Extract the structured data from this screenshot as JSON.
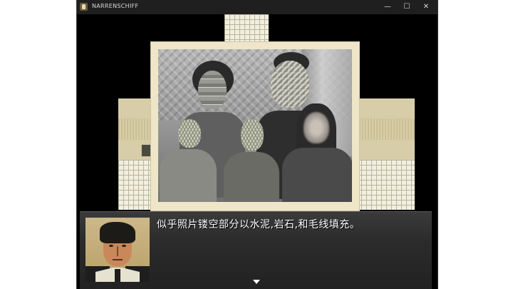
{
  "window": {
    "title": "NARRENSCHIFF",
    "icons": {
      "app": "app-icon",
      "minimize": "minimize-icon",
      "maximize": "maximize-icon",
      "close": "close-icon"
    },
    "controls": {
      "minimize": "—",
      "maximize": "☐",
      "close": "✕"
    }
  },
  "dialogue": {
    "text": "似乎照片镂空部分以水泥,岩石,和毛线填充。",
    "next_icon": "down-arrow-icon"
  },
  "colors": {
    "wall": "#d7cea9",
    "photo_frame": "#efe6c9",
    "dialog_bg": "#2b2b2b",
    "text": "#ffffff"
  }
}
